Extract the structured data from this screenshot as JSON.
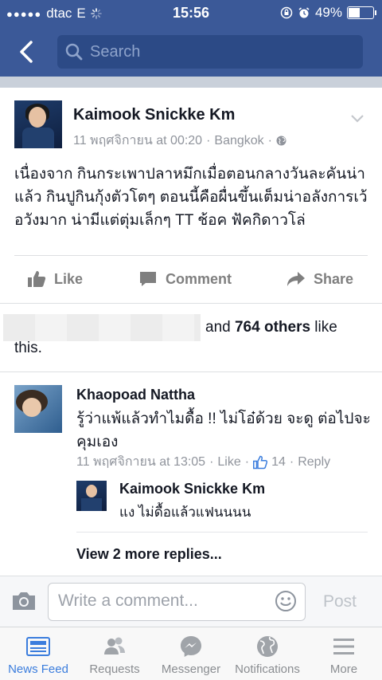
{
  "status_bar": {
    "carrier": "dtac",
    "network": "E",
    "time": "15:56",
    "battery": "49%",
    "battery_level": 0.49
  },
  "search": {
    "placeholder": "Search"
  },
  "post": {
    "author": "Kaimook Snickke Km",
    "date": "11 พฤศจิกายน at 00:20",
    "location": "Bangkok",
    "text": "เนื่องจาก กินกระเพาปลาหมึกเมื่อตอนกลางวันละคันน่าแล้ว กินปูกินกุ้งตัวโตๆ ตอนนี้คือผื่นขึ้นเต็มน่าอลังการเว้อวังมาก น่ามีแต่ตุ่มเล็กๆ TT ช้อค ฟัคกิดาวโล่",
    "actions": {
      "like": "Like",
      "comment": "Comment",
      "share": "Share"
    },
    "likes": {
      "prefix": "and ",
      "count": "764 others",
      "suffix": " like",
      "this": "this."
    }
  },
  "comment": {
    "author": "Khaopoad Nattha",
    "text": "รู้ว่าแพ้แล้วทำไมดื้อ !! ไม่โอ๋ด้วย จะดู ต่อไปจะคุมเอง",
    "date": "11 พฤศจิกายน at 13:05",
    "like_label": "Like",
    "like_count": "14",
    "reply_label": "Reply",
    "reply": {
      "author": "Kaimook Snickke Km",
      "text": "แง ไม่ดื้อแล้วแฟนนนน"
    },
    "more_replies": "View 2 more replies..."
  },
  "composer": {
    "placeholder": "Write a comment...",
    "post_label": "Post"
  },
  "tabs": [
    {
      "label": "News Feed",
      "icon": "news-feed-icon"
    },
    {
      "label": "Requests",
      "icon": "friend-requests-icon"
    },
    {
      "label": "Messenger",
      "icon": "messenger-icon"
    },
    {
      "label": "Notifications",
      "icon": "globe-icon"
    },
    {
      "label": "More",
      "icon": "menu-icon"
    }
  ],
  "colors": {
    "brand": "#3b5998",
    "active_tab": "#3b7ddd"
  }
}
